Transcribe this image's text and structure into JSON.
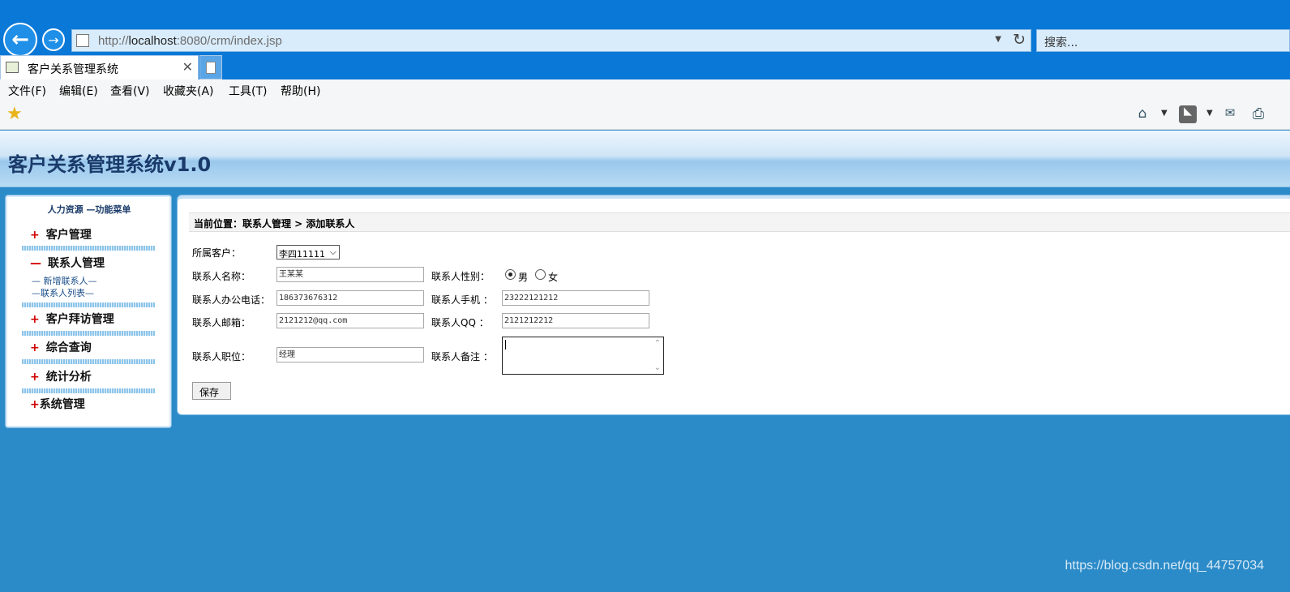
{
  "browser": {
    "url_prefix": "http://",
    "url_host": "localhost",
    "url_rest": ":8080/crm/index.jsp",
    "search_placeholder": "搜索...",
    "tab_title": "客户关系管理系统",
    "menu": [
      "文件(F)",
      "编辑(E)",
      "查看(V)",
      "收藏夹(A)",
      "工具(T)",
      "帮助(H)"
    ]
  },
  "header": {
    "title": "客户关系管理系统v1.0"
  },
  "sidebar": {
    "title": "人力资源 —功能菜单",
    "groups": [
      {
        "sign": "+",
        "label": "客户管理"
      },
      {
        "sign": "—",
        "label": "联系人管理"
      },
      {
        "sign": "+",
        "label": "客户拜访管理"
      },
      {
        "sign": "+",
        "label": "综合查询"
      },
      {
        "sign": "+",
        "label": "统计分析"
      },
      {
        "sign": "+",
        "label": "系统管理"
      }
    ],
    "sub_items": [
      "— 新增联系人—",
      "—联系人列表—"
    ]
  },
  "main": {
    "breadcrumb": "当前位置：联系人管理 > 添加联系人",
    "form": {
      "customer_label": "所属客户：",
      "customer_value": "李四11111",
      "name_label": "联系人名称：",
      "name_value": "王某某",
      "gender_label": "联系人性别：",
      "gender_male": "男",
      "gender_female": "女",
      "gender_selected": "男",
      "office_phone_label": "联系人办公电话：",
      "office_phone_value": "186373676312",
      "mobile_label": "联系人手机 ：",
      "mobile_value": "23222121212",
      "email_label": "联系人邮箱：",
      "email_value": "2121212@qq.com",
      "qq_label": "联系人QQ ：",
      "qq_value": "2121212212",
      "position_label": "联系人职位：",
      "position_value": "经理",
      "remark_label": "联系人备注 ：",
      "remark_value": "",
      "save_label": "保存"
    }
  },
  "watermark": "https://blog.csdn.net/qq_44757034"
}
